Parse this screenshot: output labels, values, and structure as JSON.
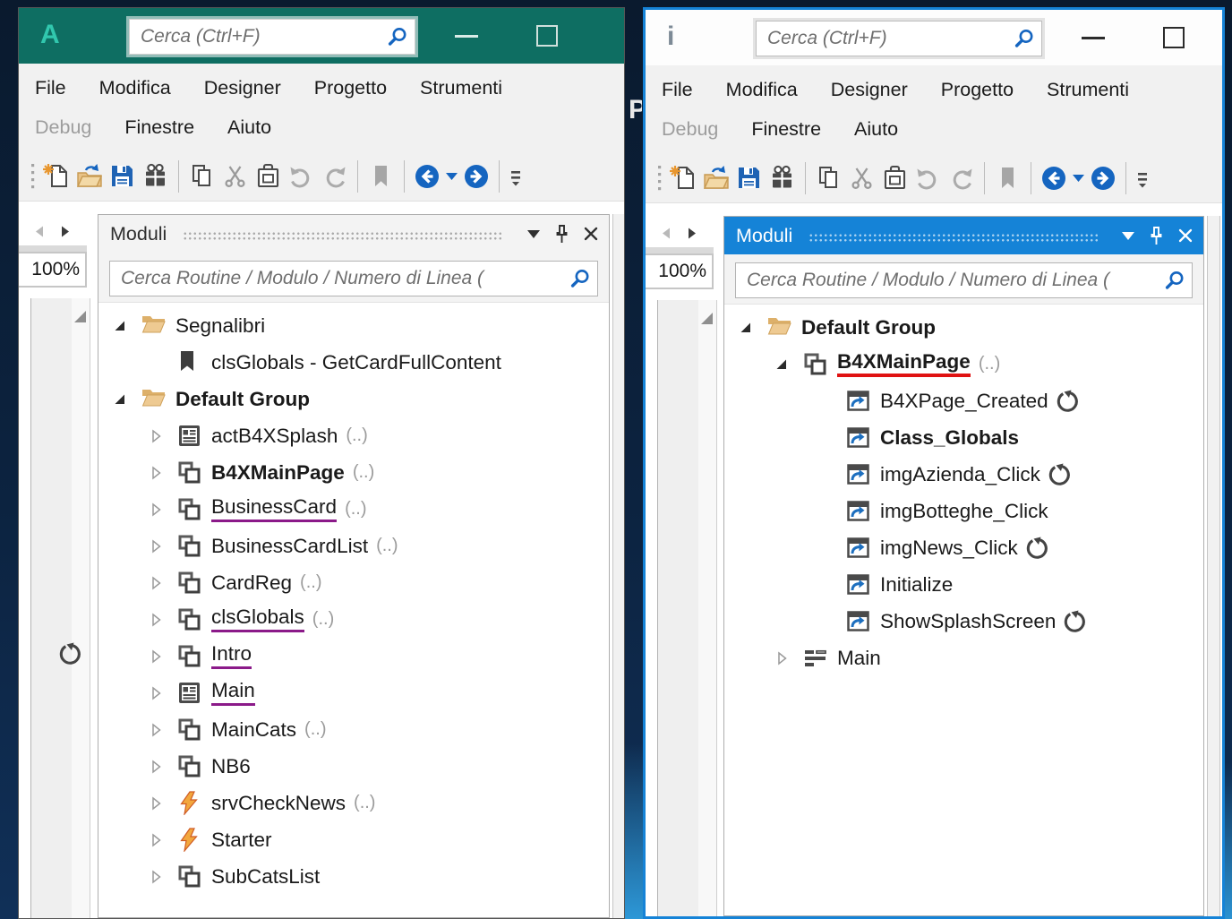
{
  "desktop": {
    "fragment_letter": "P"
  },
  "toolbar": {
    "icons": [
      "drag-handle",
      "new-file",
      "open-project",
      "save",
      "find",
      "copy",
      "cut",
      "paste",
      "undo",
      "redo",
      "bookmark",
      "back",
      "back-history-dropdown",
      "forward",
      "toolbar-options"
    ]
  },
  "colors": {
    "b4a_teal": "#0e6e62",
    "b4a_logo_teal": "#31c7ae",
    "accent_blue": "#1583d7",
    "toolbar_blue": "#1565c0",
    "purple_underline": "#8b1a89",
    "red_underline": "#e01212",
    "folder_tan": "#e9c387",
    "service_orange": "#f2a73d"
  },
  "left_window": {
    "logo": "A",
    "title_search_placeholder": "Cerca (Ctrl+F)",
    "menu_row1": [
      "File",
      "Modifica",
      "Designer",
      "Progetto",
      "Strumenti"
    ],
    "menu_row2": [
      "Debug",
      "Finestre",
      "Aiuto"
    ],
    "disabled_menu": "Debug",
    "zoom_level": "100%",
    "panel_title": "Moduli",
    "panel_search_placeholder": "Cerca Routine / Modulo / Numero di Linea (",
    "tree": [
      {
        "label": "Segnalibri",
        "icon": "folder",
        "arrow": "expanded",
        "indent": 0
      },
      {
        "label": "clsGlobals - GetCardFullContent",
        "icon": "bookmark",
        "arrow": null,
        "indent": 1
      },
      {
        "label": "Default Group",
        "icon": "folder",
        "arrow": "expanded",
        "indent": 0,
        "bold": true
      },
      {
        "label": "actB4XSplash",
        "icon": "activity",
        "arrow": "collapsed",
        "indent": 1,
        "suffix": "(..)"
      },
      {
        "label": "B4XMainPage",
        "icon": "class",
        "arrow": "collapsed",
        "indent": 1,
        "bold": true,
        "suffix": "(..)"
      },
      {
        "label": "BusinessCard",
        "icon": "class",
        "arrow": "collapsed",
        "indent": 1,
        "underline": "purple",
        "suffix": "(..)"
      },
      {
        "label": "BusinessCardList",
        "icon": "class",
        "arrow": "collapsed",
        "indent": 1,
        "suffix": "(..)"
      },
      {
        "label": "CardReg",
        "icon": "class",
        "arrow": "collapsed",
        "indent": 1,
        "suffix": "(..)"
      },
      {
        "label": "clsGlobals",
        "icon": "class",
        "arrow": "collapsed",
        "indent": 1,
        "underline": "purple",
        "suffix": "(..)"
      },
      {
        "label": "Intro",
        "icon": "class",
        "arrow": "collapsed",
        "indent": 1,
        "underline": "purple"
      },
      {
        "label": "Main",
        "icon": "activity",
        "arrow": "collapsed",
        "indent": 1,
        "underline": "purple"
      },
      {
        "label": "MainCats",
        "icon": "class",
        "arrow": "collapsed",
        "indent": 1,
        "suffix": "(..)"
      },
      {
        "label": "NB6",
        "icon": "class",
        "arrow": "collapsed",
        "indent": 1
      },
      {
        "label": "srvCheckNews",
        "icon": "service",
        "arrow": "collapsed",
        "indent": 1,
        "suffix": "(..)"
      },
      {
        "label": "Starter",
        "icon": "service",
        "arrow": "collapsed",
        "indent": 1
      },
      {
        "label": "SubCatsList",
        "icon": "class",
        "arrow": "collapsed",
        "indent": 1
      }
    ]
  },
  "right_window": {
    "logo": "i",
    "title_search_placeholder": "Cerca (Ctrl+F)",
    "menu_row1": [
      "File",
      "Modifica",
      "Designer",
      "Progetto",
      "Strumenti"
    ],
    "menu_row2": [
      "Debug",
      "Finestre",
      "Aiuto"
    ],
    "disabled_menu": "Debug",
    "zoom_level": "100%",
    "panel_title": "Moduli",
    "panel_search_placeholder": "Cerca Routine / Modulo / Numero di Linea (",
    "tree": [
      {
        "label": "Default Group",
        "icon": "folder",
        "arrow": "expanded",
        "indent": 0,
        "bold": true
      },
      {
        "label": "B4XMainPage",
        "icon": "class",
        "arrow": "expanded",
        "indent": 1,
        "bold": true,
        "underline": "red",
        "suffix": "(..)"
      },
      {
        "label": "B4XPage_Created",
        "icon": "sub",
        "arrow": null,
        "indent": 2,
        "trailing": "resumable"
      },
      {
        "label": "Class_Globals",
        "icon": "sub",
        "arrow": null,
        "indent": 2,
        "bold": true
      },
      {
        "label": "imgAzienda_Click",
        "icon": "sub",
        "arrow": null,
        "indent": 2,
        "trailing": "resumable"
      },
      {
        "label": "imgBotteghe_Click",
        "icon": "sub",
        "arrow": null,
        "indent": 2
      },
      {
        "label": "imgNews_Click",
        "icon": "sub",
        "arrow": null,
        "indent": 2,
        "trailing": "resumable"
      },
      {
        "label": "Initialize",
        "icon": "sub",
        "arrow": null,
        "indent": 2
      },
      {
        "label": "ShowSplashScreen",
        "icon": "sub",
        "arrow": null,
        "indent": 2,
        "trailing": "resumable"
      },
      {
        "label": "Main",
        "icon": "main",
        "arrow": "collapsed",
        "indent": 1
      }
    ]
  }
}
